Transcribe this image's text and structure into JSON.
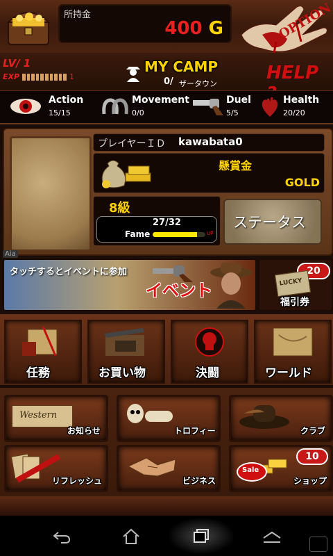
{
  "header": {
    "money_label": "所持金",
    "money_value": "400",
    "money_unit": "G",
    "option_label": "OPTION",
    "level_label": "LV/ 1",
    "exp_label": "EXP",
    "exp_value": "1",
    "camp_title": "MY CAMP",
    "camp_count": "0/",
    "camp_town": "ザータウン",
    "help_label": "HELP ?"
  },
  "stats": [
    {
      "name": "Action",
      "value": "15/15"
    },
    {
      "name": "Movement",
      "value": "0/0"
    },
    {
      "name": "Duel",
      "value": "5/5"
    },
    {
      "name": "Health",
      "value": "20/20"
    }
  ],
  "profile": {
    "player_id_label": "プレイヤーＩＤ",
    "player_id": "kawabata0",
    "bounty_label": "懸賞金",
    "bounty_unit": "GOLD",
    "rank": "8級",
    "fame_value": "27/32",
    "fame_label": "Fame",
    "fame_fraction": 0.84,
    "up_label": "UP",
    "status_button": "ステータス",
    "aia_label": "Aia"
  },
  "event": {
    "banner_text": "タッチするとイベントに参加",
    "event_label": "イベント",
    "ticket_count": "20",
    "ticket_label": "福引券",
    "ticket_lucky": "LUCKY"
  },
  "main_menu": [
    {
      "label": "任務"
    },
    {
      "label": "お買い物"
    },
    {
      "label": "決闘"
    },
    {
      "label": "ワールド"
    }
  ],
  "sub_menu": [
    {
      "label": "お知らせ",
      "sign": "Western"
    },
    {
      "label": "トロフィー"
    },
    {
      "label": "クラブ"
    },
    {
      "label": "リフレッシュ"
    },
    {
      "label": "ビジネス"
    },
    {
      "label": "ショップ",
      "badge": "10",
      "sale": "Sale"
    }
  ],
  "colors": {
    "money_red": "#e82020",
    "gold_text": "#ffd400",
    "accent_red": "#d01010"
  }
}
